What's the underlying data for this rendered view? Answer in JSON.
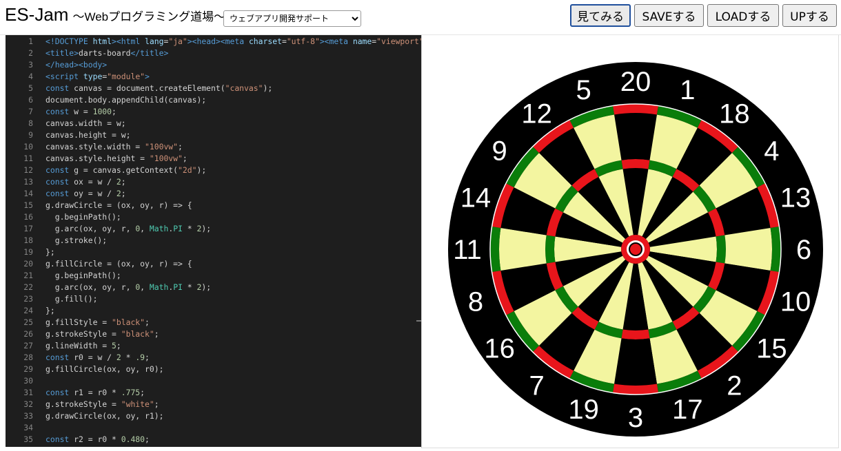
{
  "header": {
    "title": "ES-Jam",
    "subtitle": "〜Webプログラミング道場〜",
    "select": {
      "selected": "ウェブアプリ開発サポート"
    },
    "buttons": {
      "view": "見てみる",
      "save": "SAVEする",
      "load": "LOADする",
      "up": "UPする"
    }
  },
  "editor": {
    "lines": [
      {
        "n": "1",
        "html": "<span class=\"tag\">&lt;!DOCTYPE</span> <span class=\"attr\">html</span><span class=\"tag\">&gt;&lt;html</span> <span class=\"attr\">lang</span>=<span class=\"str\">\"ja\"</span><span class=\"tag\">&gt;&lt;head&gt;&lt;meta</span> <span class=\"attr\">charset</span>=<span class=\"str\">\"utf-8\"</span><span class=\"tag\">&gt;&lt;meta</span> <span class=\"attr\">name</span>=<span class=\"str\">\"viewport\"</span>"
      },
      {
        "n": "2",
        "html": "<span class=\"tag\">&lt;title&gt;</span>darts-board<span class=\"tag\">&lt;/title&gt;</span>"
      },
      {
        "n": "3",
        "html": "<span class=\"tag\">&lt;/head&gt;&lt;body&gt;</span>"
      },
      {
        "n": "4",
        "html": "<span class=\"tag\">&lt;script</span> <span class=\"attr\">type</span>=<span class=\"str\">\"module\"</span><span class=\"tag\">&gt;</span>"
      },
      {
        "n": "5",
        "html": "<span class=\"kw\">const</span> canvas = document.createElement(<span class=\"str\">\"canvas\"</span>);"
      },
      {
        "n": "6",
        "html": "document.body.appendChild(canvas);"
      },
      {
        "n": "7",
        "html": "<span class=\"kw\">const</span> w = <span class=\"num\">1000</span>;"
      },
      {
        "n": "8",
        "html": "canvas.width = w;"
      },
      {
        "n": "9",
        "html": "canvas.height = w;"
      },
      {
        "n": "10",
        "html": "canvas.style.width = <span class=\"str\">\"100vw\"</span>;"
      },
      {
        "n": "11",
        "html": "canvas.style.height = <span class=\"str\">\"100vw\"</span>;"
      },
      {
        "n": "12",
        "html": "<span class=\"kw\">const</span> g = canvas.getContext(<span class=\"str\">\"2d\"</span>);"
      },
      {
        "n": "13",
        "html": "<span class=\"kw\">const</span> ox = w / <span class=\"num\">2</span>;"
      },
      {
        "n": "14",
        "html": "<span class=\"kw\">const</span> oy = w / <span class=\"num\">2</span>;"
      },
      {
        "n": "15",
        "html": "g.drawCircle = (ox, oy, r) =&gt; {"
      },
      {
        "n": "16",
        "html": "  g.beginPath();"
      },
      {
        "n": "17",
        "html": "  g.arc(ox, oy, r, <span class=\"num\">0</span>, <span class=\"cls\">Math</span>.<span class=\"cls\">PI</span> * <span class=\"num\">2</span>);"
      },
      {
        "n": "18",
        "html": "  g.stroke();"
      },
      {
        "n": "19",
        "html": "};"
      },
      {
        "n": "20",
        "html": "g.fillCircle = (ox, oy, r) =&gt; {"
      },
      {
        "n": "21",
        "html": "  g.beginPath();"
      },
      {
        "n": "22",
        "html": "  g.arc(ox, oy, r, <span class=\"num\">0</span>, <span class=\"cls\">Math</span>.<span class=\"cls\">PI</span> * <span class=\"num\">2</span>);"
      },
      {
        "n": "23",
        "html": "  g.fill();"
      },
      {
        "n": "24",
        "html": "};"
      },
      {
        "n": "25",
        "html": "g.fillStyle = <span class=\"str\">\"black\"</span>;"
      },
      {
        "n": "26",
        "html": "g.strokeStyle = <span class=\"str\">\"black\"</span>;"
      },
      {
        "n": "27",
        "html": "g.lineWidth = <span class=\"num\">5</span>;"
      },
      {
        "n": "28",
        "html": "<span class=\"kw\">const</span> r0 = w / <span class=\"num\">2</span> * <span class=\"num\">.9</span>;"
      },
      {
        "n": "29",
        "html": "g.fillCircle(ox, oy, r0);"
      },
      {
        "n": "30",
        "html": ""
      },
      {
        "n": "31",
        "html": "<span class=\"kw\">const</span> r1 = r0 * <span class=\"num\">.775</span>;"
      },
      {
        "n": "32",
        "html": "g.strokeStyle = <span class=\"str\">\"white\"</span>;"
      },
      {
        "n": "33",
        "html": "g.drawCircle(ox, oy, r1);"
      },
      {
        "n": "34",
        "html": ""
      },
      {
        "n": "35",
        "html": "<span class=\"kw\">const</span> r2 = r0 * <span class=\"num\">0.480</span>;"
      }
    ]
  },
  "dartboard": {
    "numbers": [
      "20",
      "1",
      "18",
      "4",
      "13",
      "6",
      "10",
      "15",
      "2",
      "17",
      "3",
      "19",
      "7",
      "16",
      "8",
      "11",
      "14",
      "9",
      "12",
      "5"
    ],
    "colors": {
      "black": "#000000",
      "cream": "#f3f5a0",
      "red": "#e8151b",
      "green": "#0a7d0a",
      "white": "#ffffff"
    }
  }
}
